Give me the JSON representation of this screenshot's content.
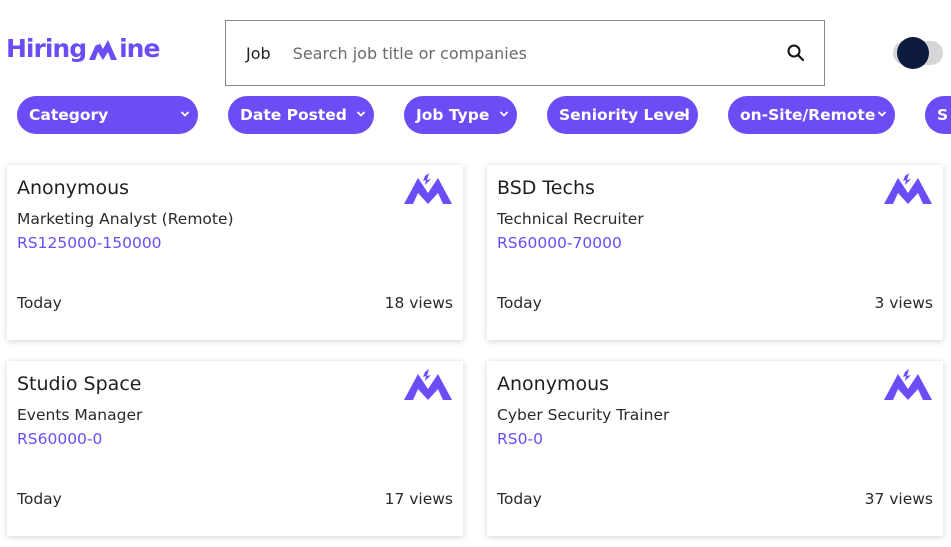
{
  "header": {
    "logo_part1": "Hiring",
    "logo_part2": "ine",
    "search_label": "Job",
    "search_placeholder": "Search job title or companies",
    "search_value": ""
  },
  "filters": [
    {
      "label": "Category"
    },
    {
      "label": "Date Posted"
    },
    {
      "label": "Job Type"
    },
    {
      "label": "Seniority Level"
    },
    {
      "label": "on-Site/Remote"
    },
    {
      "label": "S"
    }
  ],
  "jobs": [
    {
      "company": "Anonymous",
      "title": "Marketing Analyst (Remote)",
      "salary": "RS125000-150000",
      "posted": "Today",
      "views": "18 views"
    },
    {
      "company": "BSD Techs",
      "title": "Technical Recruiter",
      "salary": "RS60000-70000",
      "posted": "Today",
      "views": "3 views"
    },
    {
      "company": "Studio Space",
      "title": "Events Manager",
      "salary": "RS60000-0",
      "posted": "Today",
      "views": "17 views"
    },
    {
      "company": "Anonymous",
      "title": "Cyber Security Trainer",
      "salary": "RS0-0",
      "posted": "Today",
      "views": "37 views"
    }
  ],
  "icons": {
    "logo": "hiringmine-mountain-icon",
    "search": "search-icon",
    "chevron": "chevron-down-icon",
    "toggle": "dark-mode-toggle"
  },
  "colors": {
    "brand": "#6c4cf5",
    "toggle_knob": "#0d1b3e"
  }
}
